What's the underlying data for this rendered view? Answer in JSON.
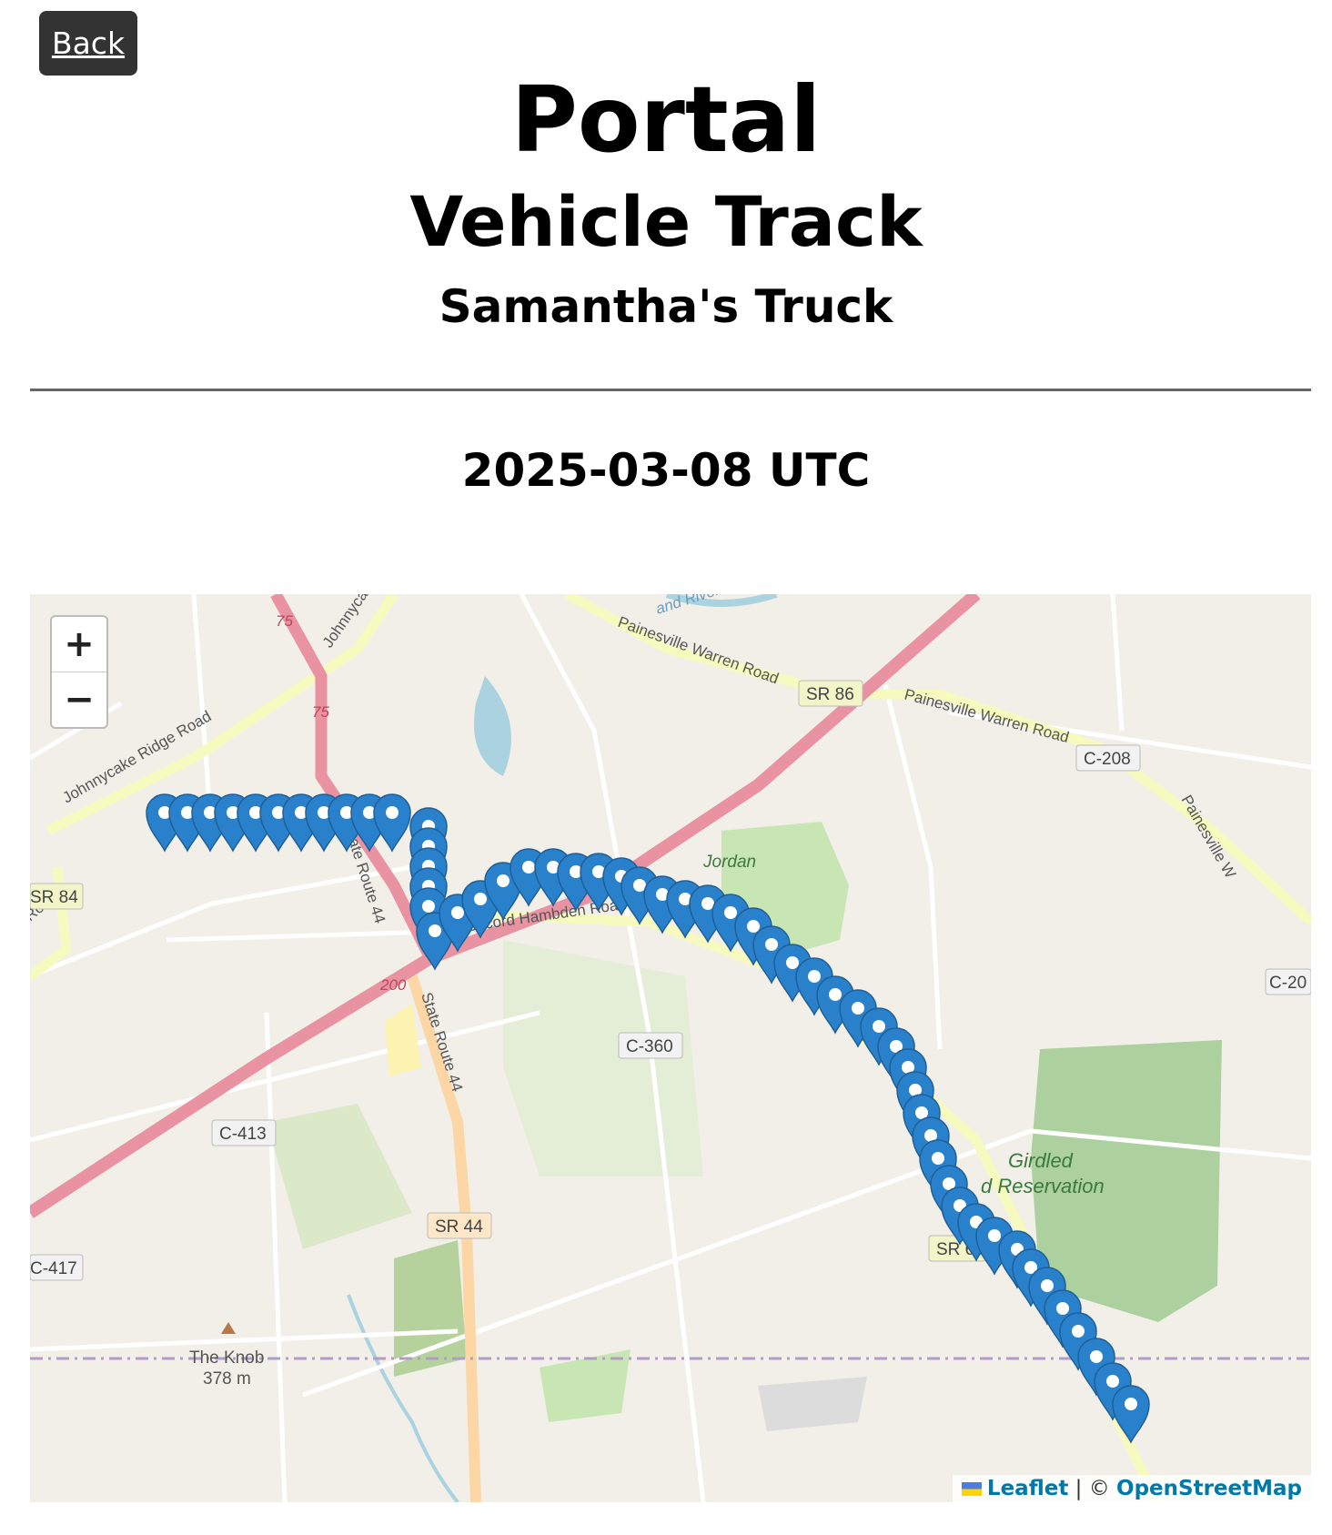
{
  "nav": {
    "back_label": "Back"
  },
  "header": {
    "title": "Portal",
    "subtitle": "Vehicle Track",
    "vehicle_name": "Samantha's Truck"
  },
  "date": "2025-03-08 UTC",
  "map": {
    "zoom_in": "+",
    "zoom_out": "−",
    "attribution_leaflet": "Leaflet",
    "attribution_sep": " | © ",
    "attribution_osm": "OpenStreetMap",
    "labels": {
      "river": "and River",
      "painesville_warren_1": "Painesville Warren Road",
      "painesville_warren_2": "Painesville Warren Road",
      "sr86": "SR 86",
      "c208": "C-208",
      "johnnycake_ridge": "Johnnycake Ridge Road",
      "johnnycake": "Johnnycake",
      "r75a": "75",
      "r75b": "75",
      "sr84": "SR 84",
      "road_left": "Road",
      "state_route_44a": "State Route 44",
      "state_route_44b": "State Route 44",
      "jordan": "Jordan",
      "concord_hambden_1": "Concord Hambden Road",
      "concord_hambden_2": "Concord Hamb",
      "r200": "200",
      "c360": "C-360",
      "c413": "C-413",
      "sr44": "SR 44",
      "c417": "C-417",
      "girdled": "Girdled",
      "reservation": "d Reservation",
      "sr608": "SR 60",
      "c20": "C-20",
      "painesville_right": "Painesville W",
      "the_knob": "The Knob",
      "elevation": "378 m"
    },
    "marker_color": "#2A81CB"
  }
}
